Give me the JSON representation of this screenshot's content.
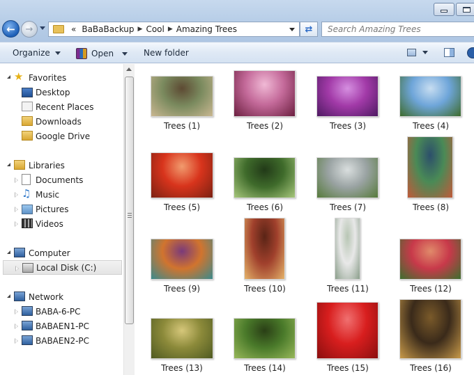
{
  "window": {
    "address": [
      "BaBaBackup",
      "Cool",
      "Amazing Trees"
    ],
    "address_prefix": "«",
    "search_placeholder": "Search Amazing Trees"
  },
  "toolbar": {
    "organize": "Organize",
    "open": "Open",
    "new_folder": "New folder"
  },
  "nav": {
    "favorites": {
      "label": "Favorites",
      "items": [
        "Desktop",
        "Recent Places",
        "Downloads",
        "Google Drive"
      ]
    },
    "libraries": {
      "label": "Libraries",
      "items": [
        "Documents",
        "Music",
        "Pictures",
        "Videos"
      ]
    },
    "computer": {
      "label": "Computer",
      "items": [
        "Local Disk (C:)"
      ]
    },
    "network": {
      "label": "Network",
      "items": [
        "BABA-6-PC",
        "BABAEN1-PC",
        "BABAEN2-PC"
      ]
    }
  },
  "files": [
    {
      "name": "Trees (1)",
      "colors": [
        "#7a8a5e",
        "#c9b791",
        "#5d4a33"
      ]
    },
    {
      "name": "Trees (2)",
      "colors": [
        "#c46a9a",
        "#6b1f3f",
        "#f0b9d5"
      ]
    },
    {
      "name": "Trees (3)",
      "colors": [
        "#a23aa8",
        "#4e1a62",
        "#d58fe0"
      ]
    },
    {
      "name": "Trees (4)",
      "colors": [
        "#6ea5d9",
        "#3e6b2c",
        "#c7ddf1"
      ]
    },
    {
      "name": "Trees (5)",
      "colors": [
        "#d8341c",
        "#7b2112",
        "#f19b6e"
      ]
    },
    {
      "name": "Trees (6)",
      "colors": [
        "#3f6b2b",
        "#a7c77c",
        "#223a18"
      ]
    },
    {
      "name": "Trees (7)",
      "colors": [
        "#9aa3a3",
        "#567a3b",
        "#d9dede"
      ]
    },
    {
      "name": "Trees (8)",
      "colors": [
        "#4a8a56",
        "#c15a3a",
        "#2c4f6b"
      ]
    },
    {
      "name": "Trees (9)",
      "colors": [
        "#d1742e",
        "#3a8a8c",
        "#7a3a7a"
      ]
    },
    {
      "name": "Trees (10)",
      "colors": [
        "#a0402c",
        "#e5b36a",
        "#5a2416"
      ]
    },
    {
      "name": "Trees (11)",
      "colors": [
        "#e8e8e8",
        "#8a9e8a",
        "#b8c6b4"
      ]
    },
    {
      "name": "Trees (12)",
      "colors": [
        "#c8394a",
        "#3c6f2e",
        "#e08a6a"
      ]
    },
    {
      "name": "Trees (13)",
      "colors": [
        "#8c8a3a",
        "#4f5a22",
        "#d6c77a"
      ]
    },
    {
      "name": "Trees (14)",
      "colors": [
        "#4a7a2a",
        "#98b85a",
        "#2a3f16"
      ]
    },
    {
      "name": "Trees (15)",
      "colors": [
        "#d81e1e",
        "#8a0f0f",
        "#f07070"
      ]
    },
    {
      "name": "Trees (16)",
      "colors": [
        "#3a2a1a",
        "#c89a4a",
        "#7a5a2a"
      ]
    }
  ]
}
